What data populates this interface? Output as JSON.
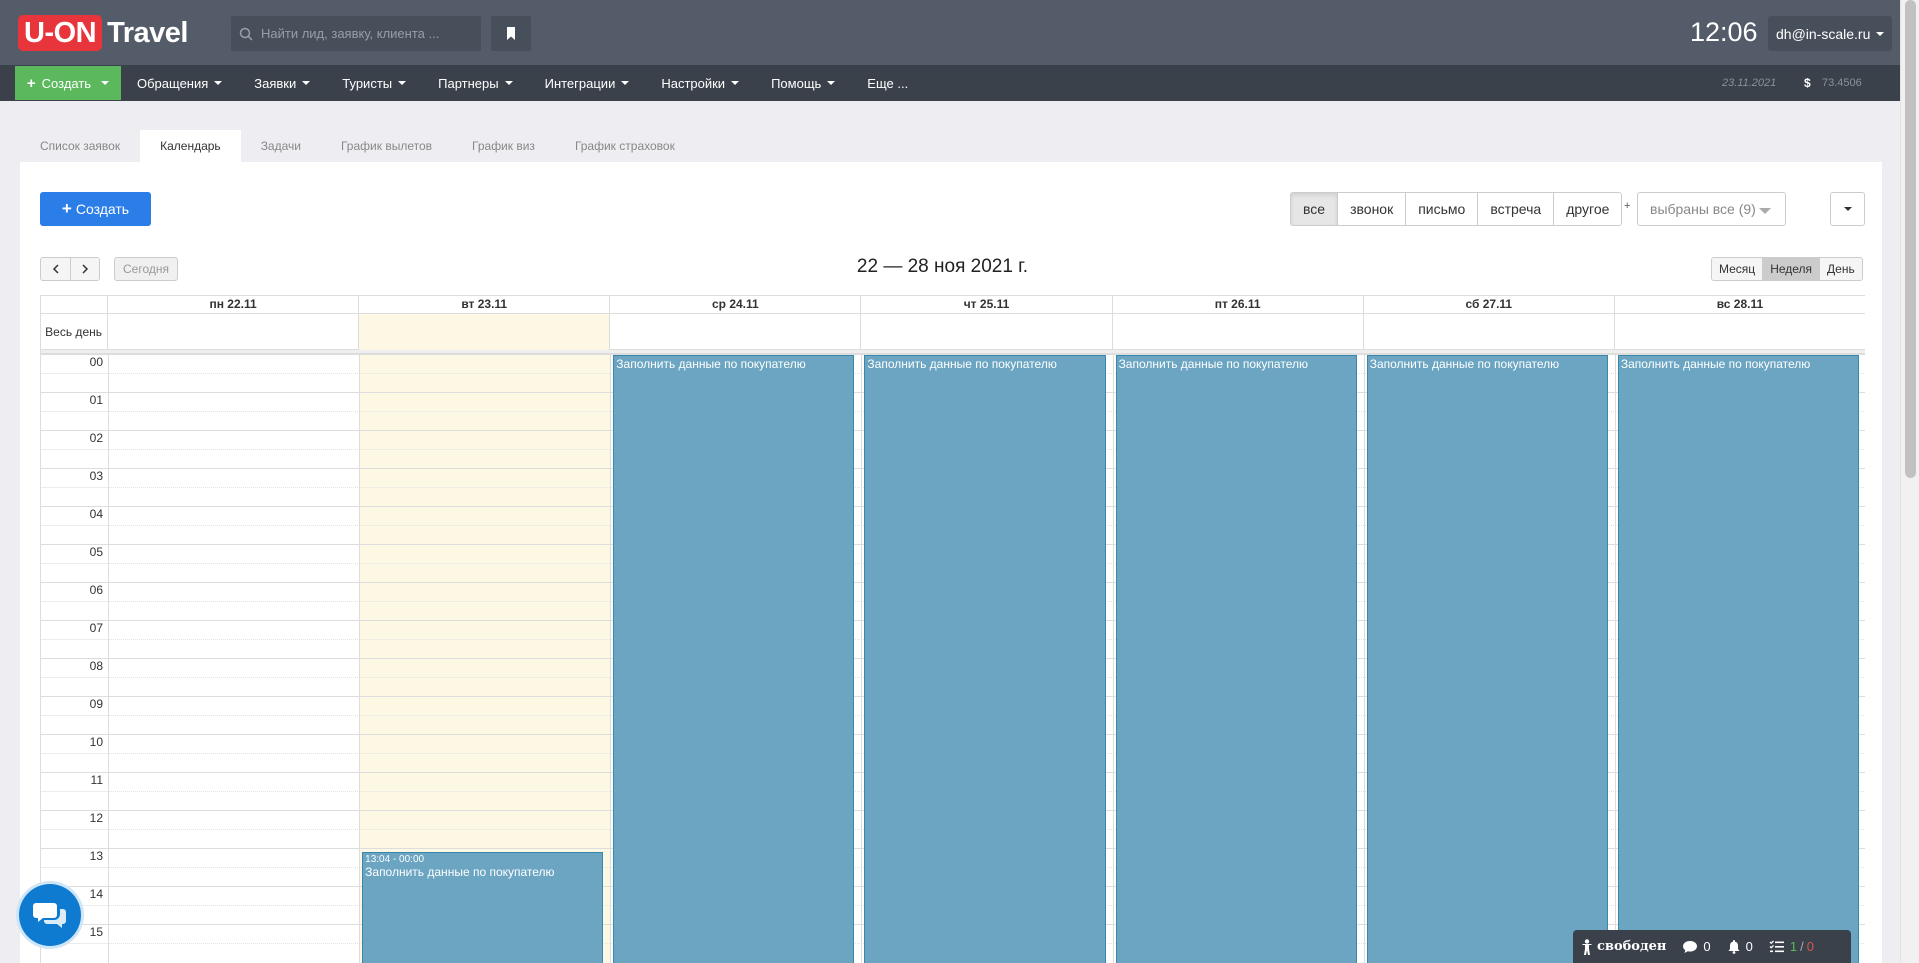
{
  "header": {
    "logo_part1": "U-ON",
    "logo_part2": "Travel",
    "search_placeholder": "Найти лид, заявку, клиента ...",
    "clock": "12:06",
    "user": "dh@in-scale.ru"
  },
  "nav": {
    "create_label": "Создать",
    "items": [
      "Обращения",
      "Заявки",
      "Туристы",
      "Партнеры",
      "Интеграции",
      "Настройки",
      "Помощь",
      "Еще ..."
    ],
    "date": "23.11.2021",
    "currency_symbol": "$",
    "rate": "73.4506"
  },
  "tabs": [
    "Список заявок",
    "Календарь",
    "Задачи",
    "График вылетов",
    "График виз",
    "График страховок"
  ],
  "active_tab": "Календарь",
  "toolbar": {
    "create_label": "Создать",
    "filters": [
      "все",
      "звонок",
      "письмо",
      "встреча",
      "другое"
    ],
    "active_filter": "все",
    "filter_plus": "+",
    "select_all": "выбраны все (9)"
  },
  "calendar": {
    "today_label": "Сегодня",
    "title": "22 — 28 ноя 2021 г.",
    "views": [
      "Месяц",
      "Неделя",
      "День"
    ],
    "active_view": "Неделя",
    "allday_label": "Весь день",
    "days": [
      "пн 22.11",
      "вт 23.11",
      "ср 24.11",
      "чт 25.11",
      "пт 26.11",
      "сб 27.11",
      "вс 28.11"
    ],
    "today_index": 1,
    "hours": [
      "00",
      "01",
      "02",
      "03",
      "04",
      "05",
      "06",
      "07",
      "08",
      "09",
      "10",
      "11",
      "12",
      "13",
      "14",
      "15"
    ],
    "events": [
      {
        "day": 1,
        "time": "13:04 - 00:00",
        "title": "Заполнить данные по покупателю",
        "start_hour": 13.07
      },
      {
        "day": 2,
        "title": "Заполнить данные по покупателю",
        "start_hour": 0
      },
      {
        "day": 3,
        "title": "Заполнить данные по покупателю",
        "start_hour": 0
      },
      {
        "day": 4,
        "title": "Заполнить данные по покупателю",
        "start_hour": 0
      },
      {
        "day": 5,
        "title": "Заполнить данные по покупателю",
        "start_hour": 0
      },
      {
        "day": 6,
        "title": "Заполнить данные по покупателю",
        "start_hour": 0
      }
    ]
  },
  "status_bar": {
    "status": "свободен",
    "messages": "0",
    "notifications": "0",
    "tasks_done": "1",
    "tasks_sep": "/",
    "tasks_overdue": "0"
  },
  "colors": {
    "brand_red": "#e8343b",
    "create_green": "#5cb85c",
    "primary_blue": "#2b7ee8",
    "event_blue": "#6ba5c2",
    "today_bg": "#fcf8e3"
  }
}
